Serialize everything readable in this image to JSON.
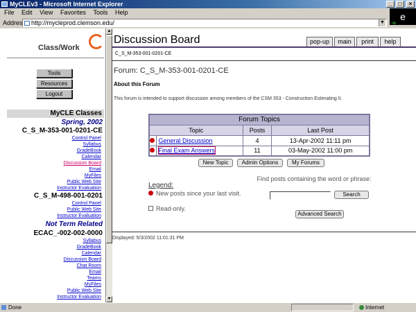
{
  "window": {
    "title": "MyCLEv3 - Microsoft Internet Explorer",
    "min": "_",
    "max": "□",
    "close": "×"
  },
  "menu": [
    "File",
    "Edit",
    "View",
    "Favorites",
    "Tools",
    "Help"
  ],
  "address": {
    "label": "Address",
    "url": "http://mycleprod.clemson.edu/",
    "go": "Go"
  },
  "sidebar": {
    "header": "Class/Work",
    "buttons": [
      "Tools",
      "Resources",
      "Logout"
    ],
    "classes_label": "MyCLE Classes",
    "term": "Spring, 2002",
    "courses": [
      {
        "code": "C_S_M-353-001-0201-CE",
        "links": [
          "Control Panel",
          "Syllabus",
          "GradeBook",
          "Calendar",
          "Discussion Board",
          "Email",
          "MyFiles",
          "Public Web Site",
          "Instructor Evaluation"
        ]
      },
      {
        "code": "C_S_M-498-001-0201",
        "links": [
          "Control Panel",
          "Public Web Site",
          "Instructor Evaluation"
        ]
      }
    ],
    "term2": "Not Term Related",
    "course3": {
      "code": "ECAC_-002-002-0000",
      "links": [
        "Syllabus",
        "GradeBook",
        "Calendar",
        "Discussion Board",
        "Chat Room",
        "Email",
        "Teams",
        "MyFiles",
        "Public Web Site",
        "Instructor Evaluation"
      ]
    }
  },
  "main": {
    "title": "Discussion Board",
    "course_code": "C_S_M-353-001-0201-CE",
    "tabs": [
      "pop-up",
      "main",
      "print",
      "help"
    ],
    "forum_heading": "Forum: C_S_M-353-001-0201-CE",
    "about_label": "About this Forum",
    "about_desc": "This forum is intended to support discussion among members of the CSM 353 - Construction Estimating II.",
    "table": {
      "caption": "Forum Topics",
      "columns": [
        "Topic",
        "Posts",
        "Last Post"
      ],
      "rows": [
        {
          "topic": "General Discussion",
          "posts": "4",
          "last": "13-Apr-2002 11:11 pm"
        },
        {
          "topic": "Final Exam Answers",
          "posts": "11",
          "last": "03-May-2002 11:00 pm"
        }
      ]
    },
    "actions": [
      "New Topic",
      "Admin Options",
      "My Forums"
    ],
    "legend": {
      "title": "Legend:",
      "new_posts": "New posts since your last visit.",
      "read_only": "Read-only."
    },
    "find": {
      "label": "Find posts containing the word or phrase:",
      "value": "",
      "search": "Search",
      "advanced": "Advanced Search"
    },
    "displayed": "Displayed: 5/3/2002 11:01:31 PM"
  },
  "status": {
    "text": "Done",
    "zone": "Internet"
  }
}
